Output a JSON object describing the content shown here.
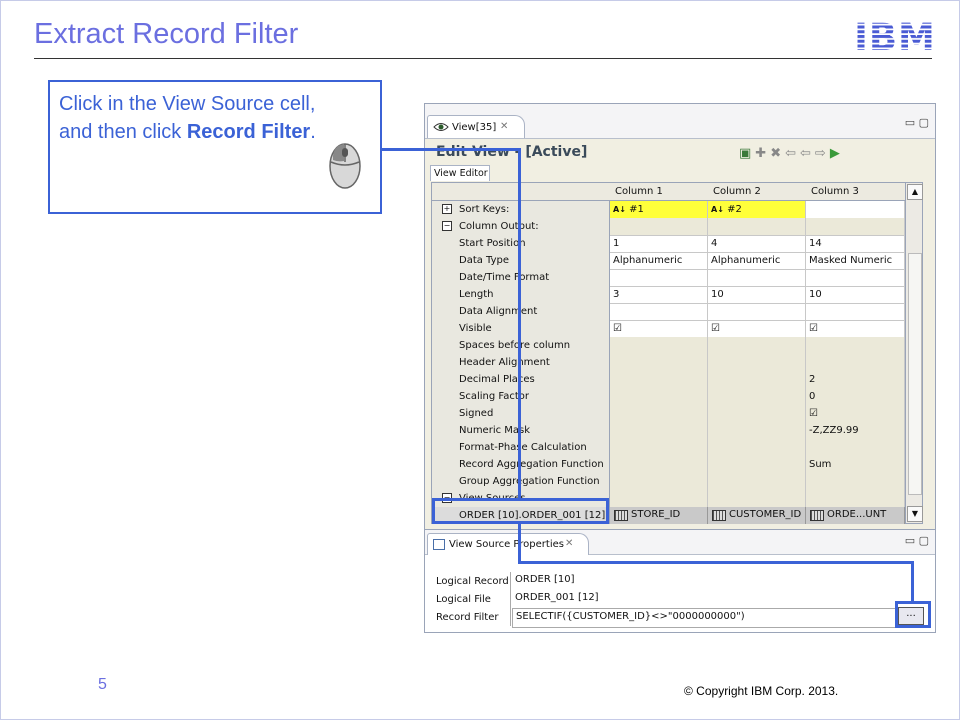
{
  "slide": {
    "title": "Extract Record Filter",
    "page_number": "5",
    "copyright": "© Copyright  IBM Corp. 2013.",
    "callout_line1": "Click in the View Source cell,",
    "callout_line2a": "and then click ",
    "callout_line2b": "Record Filter",
    "callout_line2c": ".",
    "logo_text": "IBM",
    "accent_color": "#3b62d6",
    "title_color": "#6b6fe0"
  },
  "editor": {
    "tab_label": "View[35]",
    "title": "Edit View - [Active]",
    "subtab": "View Editor",
    "columns": [
      "Column 1",
      "Column 2",
      "Column 3"
    ],
    "sort_keys": {
      "label": "Sort Keys:",
      "values": [
        "#1",
        "#2",
        ""
      ]
    },
    "column_output_label": "Column Output:",
    "rows": [
      {
        "label": "Start Position",
        "values": [
          "1",
          "4",
          "14"
        ],
        "tan": false
      },
      {
        "label": "Data Type",
        "values": [
          "Alphanumeric",
          "Alphanumeric",
          "Masked Numeric"
        ],
        "tan": false
      },
      {
        "label": "Date/Time Format",
        "values": [
          "",
          "",
          ""
        ],
        "tan": false
      },
      {
        "label": "Length",
        "values": [
          "3",
          "10",
          "10"
        ],
        "tan": false
      },
      {
        "label": "Data Alignment",
        "values": [
          "",
          "",
          ""
        ],
        "tan": false
      },
      {
        "label": "Visible",
        "values": [
          "☑",
          "☑",
          "☑"
        ],
        "tan": false
      },
      {
        "label": "Spaces before column",
        "values": [
          "",
          "",
          ""
        ],
        "tan": true
      },
      {
        "label": "Header Alignment",
        "values": [
          "",
          "",
          ""
        ],
        "tan": true
      },
      {
        "label": "Decimal Places",
        "values": [
          "",
          "",
          "2"
        ],
        "tan": true
      },
      {
        "label": "Scaling Factor",
        "values": [
          "",
          "",
          "0"
        ],
        "tan": true
      },
      {
        "label": "Signed",
        "values": [
          "",
          "",
          "☑"
        ],
        "tan": true
      },
      {
        "label": "Numeric Mask",
        "values": [
          "",
          "",
          "-Z,ZZ9.99"
        ],
        "tan": true
      },
      {
        "label": "Format-Phase Calculation",
        "values": [
          "",
          "",
          ""
        ],
        "tan": true
      },
      {
        "label": "Record Aggregation Function",
        "values": [
          "",
          "",
          "Sum"
        ],
        "tan": true
      },
      {
        "label": "Group Aggregation Function",
        "values": [
          "",
          "",
          ""
        ],
        "tan": true
      }
    ],
    "view_sources_label": "View Sources",
    "source_row": {
      "label": "ORDER [10].ORDER_001 [12]",
      "values": [
        "STORE_ID",
        "CUSTOMER_ID",
        "ORDE...UNT"
      ]
    }
  },
  "properties": {
    "tab_label": "View Source Properties",
    "logical_record_label": "Logical Record",
    "logical_record_value": "ORDER [10]",
    "logical_file_label": "Logical File",
    "logical_file_value": "ORDER_001 [12]",
    "record_filter_label": "Record Filter",
    "record_filter_value": "SELECTIF({CUSTOMER_ID}<>\"0000000000\")",
    "ellipsis_label": "..."
  }
}
